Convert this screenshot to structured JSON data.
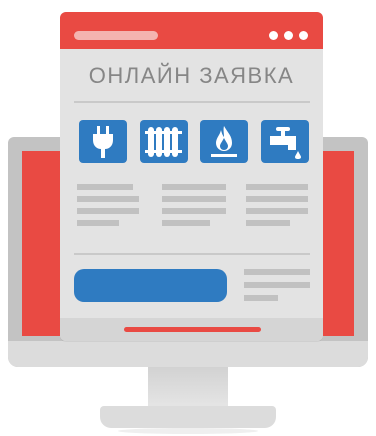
{
  "form": {
    "title": "ОНЛАЙН ЗАЯВКА"
  },
  "services": [
    {
      "icon": "electric-plug-icon"
    },
    {
      "icon": "radiator-icon"
    },
    {
      "icon": "gas-flame-icon"
    },
    {
      "icon": "water-tap-icon"
    }
  ],
  "colors": {
    "accent_red": "#e94a43",
    "accent_blue": "#2f7bc1",
    "window_bg": "#e3e3e3",
    "monitor_gray": "#c3c3c3",
    "placeholder_gray": "#c1c1c1"
  }
}
